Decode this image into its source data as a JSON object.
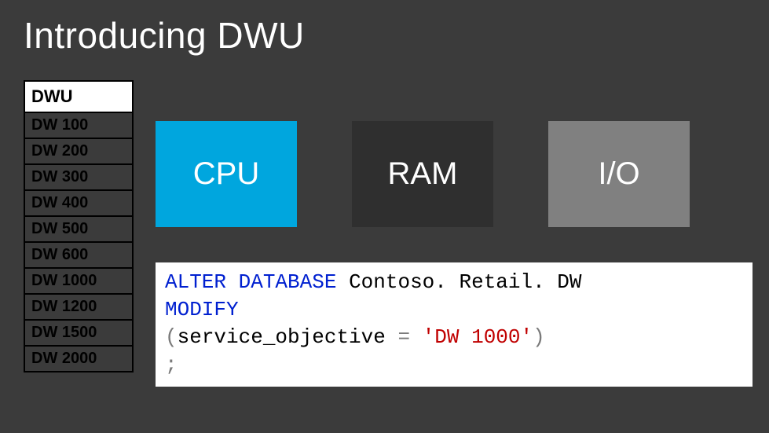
{
  "title": "Introducing DWU",
  "table": {
    "header": "DWU",
    "rows": [
      "DW 100",
      "DW 200",
      "DW 300",
      "DW 400",
      "DW 500",
      "DW 600",
      "DW 1000",
      "DW 1200",
      "DW 1500",
      "DW 2000"
    ]
  },
  "tiles": {
    "cpu": "CPU",
    "ram": "RAM",
    "io": "I/O"
  },
  "code": {
    "alter": "ALTER",
    "database": "DATABASE",
    "db_name": "Contoso. Retail. DW",
    "modify": "MODIFY",
    "lparen": "(",
    "param": "service_objective",
    "eq": "=",
    "value": "'DW 1000'",
    "rparen": ")",
    "semicolon": ";"
  }
}
